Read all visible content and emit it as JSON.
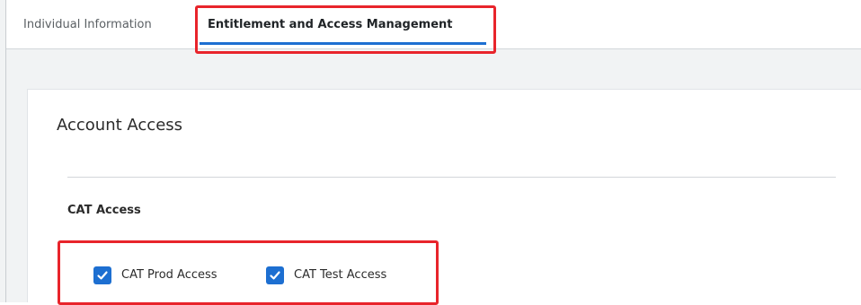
{
  "tabs": {
    "individual_label": "Individual Information",
    "entitlement_label": "Entitlement and Access Management",
    "active": "Entitlement and Access Management"
  },
  "account_access": {
    "title": "Account Access",
    "cat_access": {
      "title": "CAT Access",
      "options": [
        {
          "label": "CAT Prod Access",
          "checked": true
        },
        {
          "label": "CAT Test Access",
          "checked": true
        }
      ]
    }
  },
  "colors": {
    "accent": "#1d6fd1",
    "highlight": "#e8242b",
    "page_background": "#f1f3f4"
  },
  "icons": {
    "checkbox": "checkmark-icon"
  }
}
